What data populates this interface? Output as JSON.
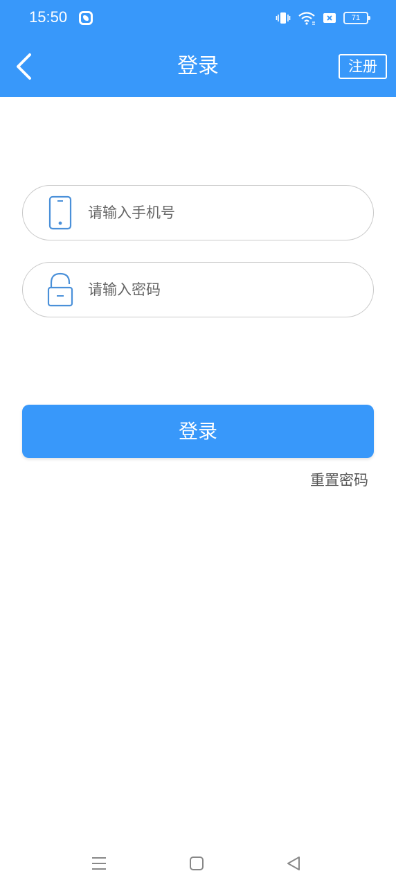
{
  "status_bar": {
    "time": "15:50",
    "battery": "71",
    "icons": [
      "app-icon",
      "vibrate-icon",
      "wifi-icon",
      "sim-off-icon",
      "battery-icon"
    ]
  },
  "header": {
    "title": "登录",
    "register_label": "注册",
    "back_icon": "chevron-left-icon"
  },
  "form": {
    "phone_placeholder": "请输入手机号",
    "phone_value": "",
    "phone_icon": "phone-icon",
    "password_placeholder": "请输入密码",
    "password_value": "",
    "password_icon": "lock-icon",
    "login_label": "登录",
    "reset_label": "重置密码"
  },
  "nav_bar": {
    "icons": [
      "menu-icon",
      "home-icon",
      "back-triangle-icon"
    ]
  },
  "colors": {
    "brand": "#3898fa",
    "field_border": "#c9c9c9",
    "icon_blue": "#4a90d9"
  }
}
